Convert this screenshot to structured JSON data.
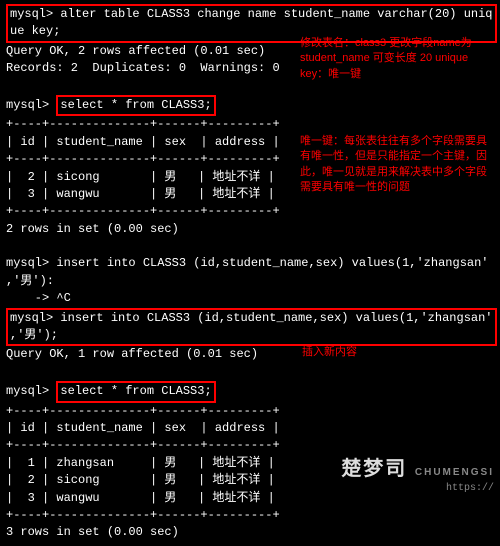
{
  "prompt": "mysql>",
  "cmd1a": "alter table CLASS3 change name student_name varchar(20) uniq",
  "cmd1b": "ue key;",
  "res1a": "Query OK, 2 rows affected (0.01 sec)",
  "res1b": "Records: 2  Duplicates: 0  Warnings: 0",
  "cmd2": "select * from CLASS3;",
  "tbl1_sep": "+----+--------------+------+---------+",
  "tbl1_head": "| id | student_name | sex  | address |",
  "tbl1_r1": "|  2 | sicong       | 男   | 地址不详 |",
  "tbl1_r2": "|  3 | wangwu       | 男   | 地址不详 |",
  "res2": "2 rows in set (0.00 sec)",
  "cmd3a": "insert into CLASS3 (id,student_name,sex) values(1,'zhangsan'",
  "cmd3b": ",'男'):",
  "cmd3c": "    -> ^C",
  "cmd4a": "insert into CLASS3 (id,student_name,sex) values(1,'zhangsan'",
  "cmd4b": ",'男');",
  "res4": "Query OK, 1 row affected (0.01 sec)",
  "cmd5": "select * from CLASS3;",
  "tbl2_sep": "+----+--------------+------+---------+",
  "tbl2_head": "| id | student_name | sex  | address |",
  "tbl2_r1": "|  1 | zhangsan     | 男   | 地址不详 |",
  "tbl2_r2": "|  2 | sicong       | 男   | 地址不详 |",
  "tbl2_r3": "|  3 | wangwu       | 男   | 地址不详 |",
  "res5": "3 rows in set (0.00 sec)",
  "note1": "修改表名：class3 更改字段name为 student_name 可变长度 20 unique key：唯一键",
  "note2": "唯一键：每张表往往有多个字段需要具有唯一性，但是只能指定一个主键，因此，唯一见就是用来解决表中多个字段需要具有唯一性的问题",
  "note3": "插入新内容",
  "wm_cn": "楚梦司",
  "wm_en": "CHUMENGSI",
  "wm_url": "https://"
}
